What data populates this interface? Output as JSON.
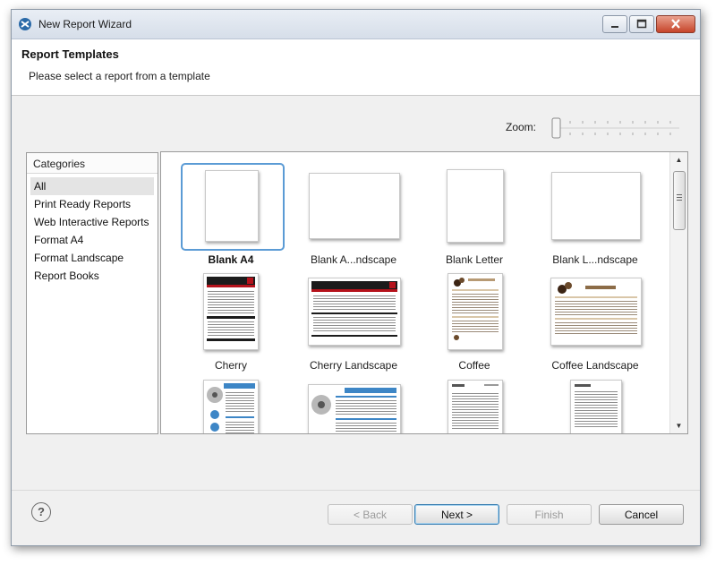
{
  "window": {
    "title": "New Report Wizard",
    "controls": [
      "minimize-icon",
      "maximize-icon",
      "close-icon"
    ]
  },
  "header": {
    "title": "Report Templates",
    "subtitle": "Please select a report from a template"
  },
  "zoom": {
    "label": "Zoom:",
    "level": 0
  },
  "categories": {
    "header": "Categories",
    "items": [
      {
        "label": "All",
        "selected": true
      },
      {
        "label": "Print Ready Reports",
        "selected": false
      },
      {
        "label": "Web Interactive Reports",
        "selected": false
      },
      {
        "label": "Format A4",
        "selected": false
      },
      {
        "label": "Format Landscape",
        "selected": false
      },
      {
        "label": "Report Books",
        "selected": false
      }
    ]
  },
  "templates": {
    "items": [
      {
        "label": "Blank A4",
        "selected": true
      },
      {
        "label": "Blank A...ndscape",
        "selected": false
      },
      {
        "label": "Blank Letter",
        "selected": false
      },
      {
        "label": "Blank L...ndscape",
        "selected": false
      },
      {
        "label": "Cherry",
        "selected": false
      },
      {
        "label": "Cherry Landscape",
        "selected": false
      },
      {
        "label": "Coffee",
        "selected": false
      },
      {
        "label": "Coffee Landscape",
        "selected": false
      }
    ]
  },
  "buttons": {
    "help": "?",
    "back": "< Back",
    "next": "Next >",
    "finish": "Finish",
    "cancel": "Cancel"
  },
  "colors": {
    "selection_border": "#5b9bd5",
    "window_frame": "#8e9aa8",
    "close_button": "#c6442a",
    "cherry_accent": "#b5121b",
    "flower_accent": "#3d86c6",
    "coffee_accent": "#6b4a2b"
  }
}
